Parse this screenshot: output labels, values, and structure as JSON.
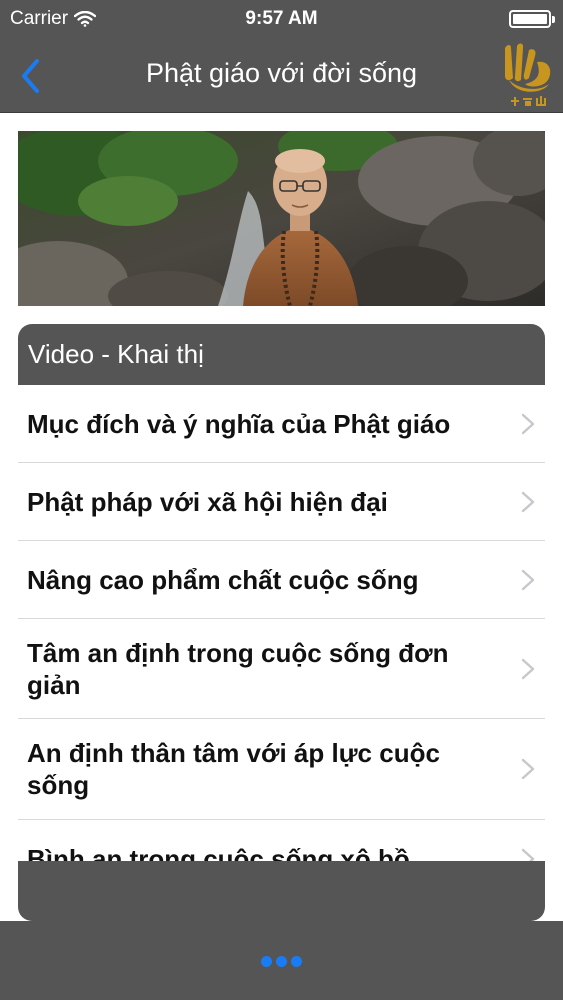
{
  "status_bar": {
    "carrier": "Carrier",
    "time": "9:57 AM"
  },
  "nav": {
    "title": "Phật giáo với đời sống",
    "back_icon": "chevron-left-icon",
    "logo_icon": "temple-logo-icon"
  },
  "section": {
    "title": "Video - Khai thị"
  },
  "items": [
    {
      "label": "Mục đích và ý nghĩa của Phật giáo"
    },
    {
      "label": "Phật pháp với xã hội hiện đại"
    },
    {
      "label": "Nâng cao phẩm chất cuộc sống"
    },
    {
      "label": "Tâm an định trong cuộc sống đơn giản"
    },
    {
      "label": "An định thân tâm với áp lực cuộc sống"
    },
    {
      "label": "Bình an trong cuộc sống xô bồ"
    }
  ],
  "colors": {
    "bar": "#555555",
    "accent": "#1a7cf5",
    "logo": "#c8951f"
  }
}
